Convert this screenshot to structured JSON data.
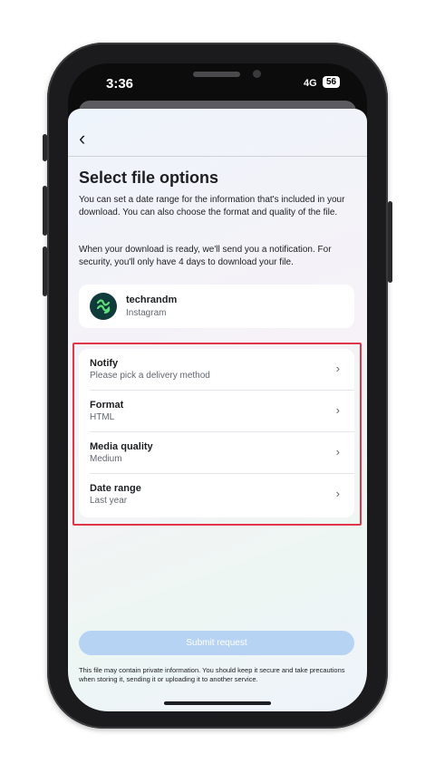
{
  "status_bar": {
    "time": "3:36",
    "network": "4G",
    "battery": "56"
  },
  "header": {
    "back_icon": "chevron-left-icon"
  },
  "page": {
    "title": "Select file options",
    "description_1": "You can set a date range for the information that's included in your download. You can also choose the format and quality of the file.",
    "description_2": "When your download is ready, we'll send you a notification. For security, you'll only have 4 days to download your file."
  },
  "account": {
    "name": "techrandm",
    "platform": "Instagram",
    "avatar_color": "#0f3b3a"
  },
  "options": [
    {
      "label": "Notify",
      "value": "Please pick a delivery method"
    },
    {
      "label": "Format",
      "value": "HTML"
    },
    {
      "label": "Media quality",
      "value": "Medium"
    },
    {
      "label": "Date range",
      "value": "Last year"
    }
  ],
  "submit": {
    "label": "Submit request"
  },
  "footer_note": "This file may contain private information. You should keep it secure and take precautions when storing it, sending it or uploading it to another service.",
  "colors": {
    "highlight": "#e0364a",
    "submit_bg": "#b6d3f4"
  }
}
